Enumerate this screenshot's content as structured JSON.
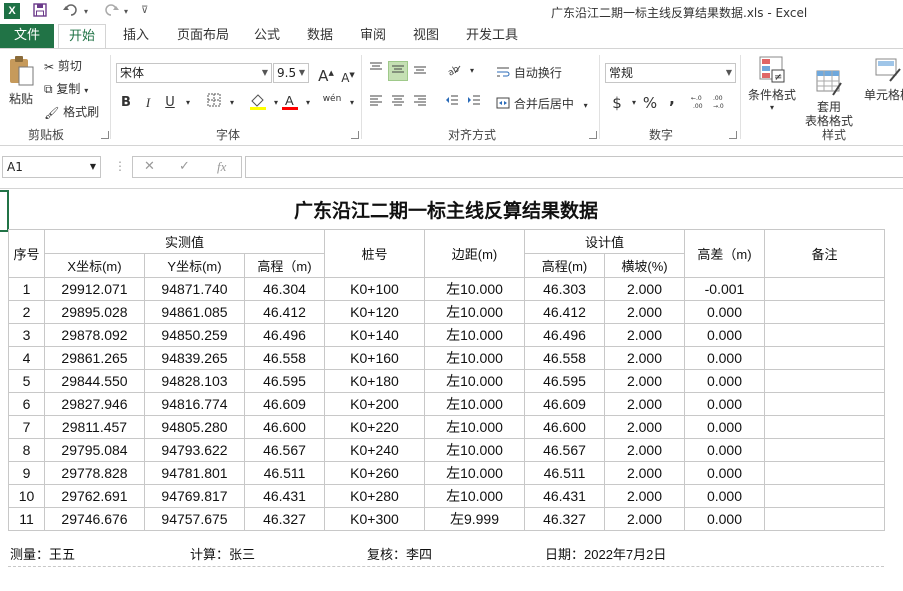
{
  "window": {
    "doc_title": "广东沿江二期一标主线反算结果数据.xls - Excel",
    "app_icon": "X"
  },
  "quick_access": {
    "save_icon": "save-icon",
    "undo_icon": "undo-icon",
    "redo_icon": "redo-icon",
    "customize_icon": "customize-icon"
  },
  "tabs": [
    "文件",
    "开始",
    "插入",
    "页面布局",
    "公式",
    "数据",
    "审阅",
    "视图",
    "开发工具"
  ],
  "ribbon": {
    "clipboard": {
      "paste": "粘贴",
      "cut": "剪切",
      "copy": "复制",
      "format_painter": "格式刷",
      "group": "剪贴板"
    },
    "font": {
      "name": "宋体",
      "size": "9.5",
      "bold": "B",
      "italic": "I",
      "underline": "U",
      "group": "字体",
      "grow": "A",
      "shrink": "A",
      "phonetic": "wén"
    },
    "alignment": {
      "wrap": "自动换行",
      "merge": "合并后居中",
      "group": "对齐方式"
    },
    "number": {
      "format": "常规",
      "currency": "$",
      "percent": "%",
      "comma": ",",
      "group": "数字"
    },
    "styles": {
      "conditional": "条件格式",
      "table_format": "套用\n表格格式",
      "cell_styles": "单元格样",
      "group": "样式"
    }
  },
  "formula_bar": {
    "name_box": "A1",
    "cancel": "✕",
    "enter": "✓",
    "fx": "fx",
    "value": ""
  },
  "sheet": {
    "title": "广东沿江二期一标主线反算结果数据",
    "headers": {
      "seq": "序号",
      "measured": "实测值",
      "x": "X坐标(m)",
      "y": "Y坐标(m)",
      "elev": "高程（m)",
      "station": "桩号",
      "offset": "边距(m)",
      "design": "设计值",
      "design_elev": "高程(m)",
      "slope": "横坡(%)",
      "diff": "高差（m)",
      "remark": "备注"
    },
    "rows": [
      [
        "1",
        "29912.071",
        "94871.740",
        "46.304",
        "K0+100",
        "左10.000",
        "46.303",
        "2.000",
        "-0.001",
        ""
      ],
      [
        "2",
        "29895.028",
        "94861.085",
        "46.412",
        "K0+120",
        "左10.000",
        "46.412",
        "2.000",
        "0.000",
        ""
      ],
      [
        "3",
        "29878.092",
        "94850.259",
        "46.496",
        "K0+140",
        "左10.000",
        "46.496",
        "2.000",
        "0.000",
        ""
      ],
      [
        "4",
        "29861.265",
        "94839.265",
        "46.558",
        "K0+160",
        "左10.000",
        "46.558",
        "2.000",
        "0.000",
        ""
      ],
      [
        "5",
        "29844.550",
        "94828.103",
        "46.595",
        "K0+180",
        "左10.000",
        "46.595",
        "2.000",
        "0.000",
        ""
      ],
      [
        "6",
        "29827.946",
        "94816.774",
        "46.609",
        "K0+200",
        "左10.000",
        "46.609",
        "2.000",
        "0.000",
        ""
      ],
      [
        "7",
        "29811.457",
        "94805.280",
        "46.600",
        "K0+220",
        "左10.000",
        "46.600",
        "2.000",
        "0.000",
        ""
      ],
      [
        "8",
        "29795.084",
        "94793.622",
        "46.567",
        "K0+240",
        "左10.000",
        "46.567",
        "2.000",
        "0.000",
        ""
      ],
      [
        "9",
        "29778.828",
        "94781.801",
        "46.511",
        "K0+260",
        "左10.000",
        "46.511",
        "2.000",
        "0.000",
        ""
      ],
      [
        "10",
        "29762.691",
        "94769.817",
        "46.431",
        "K0+280",
        "左10.000",
        "46.431",
        "2.000",
        "0.000",
        ""
      ],
      [
        "11",
        "29746.676",
        "94757.675",
        "46.327",
        "K0+300",
        "左9.999",
        "46.327",
        "2.000",
        "0.000",
        ""
      ]
    ],
    "footer": {
      "surveyor": "测量：王五",
      "calculator": "计算：张三",
      "reviewer": "复核：李四",
      "date": "日期：2022年7月2日"
    }
  },
  "colors": {
    "accent": "#217346",
    "selected_fill": "#c5e0b4"
  }
}
